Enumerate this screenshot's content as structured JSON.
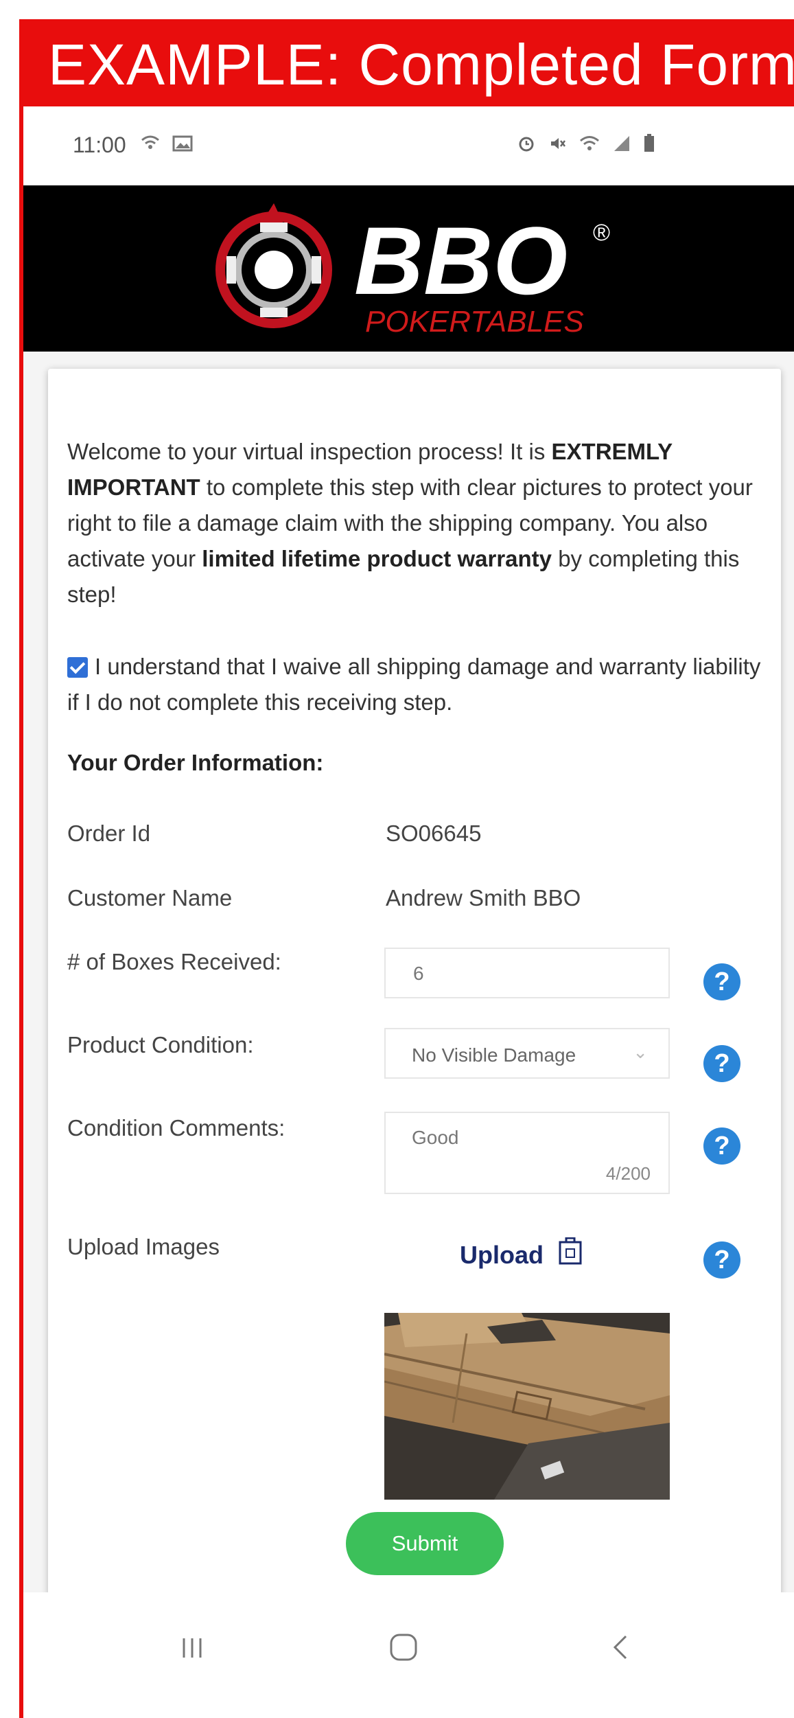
{
  "banner": {
    "text": "EXAMPLE: Completed  Form"
  },
  "status_bar": {
    "time": "11:00",
    "left_icons": [
      "wifi-call-icon",
      "image-icon"
    ],
    "right_icons": [
      "alarm-icon",
      "mute-icon",
      "wifi-icon",
      "signal-icon",
      "battery-icon"
    ]
  },
  "brand": {
    "logo_text": "BBO",
    "registered": "®",
    "tagline": "POKERTABLES"
  },
  "intro": {
    "p1": "Welcome to your virtual inspection process! It is ",
    "b1": "EXTREMLY IMPORTANT",
    "p2": " to complete this step with clear pictures to protect your right to file a damage claim with the shipping company. You also activate your ",
    "b2": "limited lifetime product warranty",
    "p3": " by completing this step!"
  },
  "acknowledgement": {
    "checked": true,
    "text": "I understand that I waive all shipping damage and warranty liability if I do not complete this receiving step."
  },
  "order_section": {
    "title": "Your Order Information:",
    "order_id_label": "Order Id",
    "order_id_value": "SO06645",
    "customer_label": "Customer Name",
    "customer_value": "Andrew Smith BBO",
    "boxes_label": "# of Boxes Received:",
    "boxes_value": "6",
    "condition_label": "Product Condition:",
    "condition_value": "No Visible Damage",
    "comments_label": "Condition Comments:",
    "comments_value": "Good",
    "comments_count": "4/200",
    "images_label": "Upload Images",
    "upload_label": "Upload"
  },
  "help_icon": "?",
  "submit_label": "Submit",
  "colors": {
    "banner_red": "#e80d0d",
    "help_blue": "#2b86d8",
    "submit_green": "#3cc05a",
    "checkbox_blue": "#2f6fd6",
    "upload_navy": "#1a2a6c"
  }
}
